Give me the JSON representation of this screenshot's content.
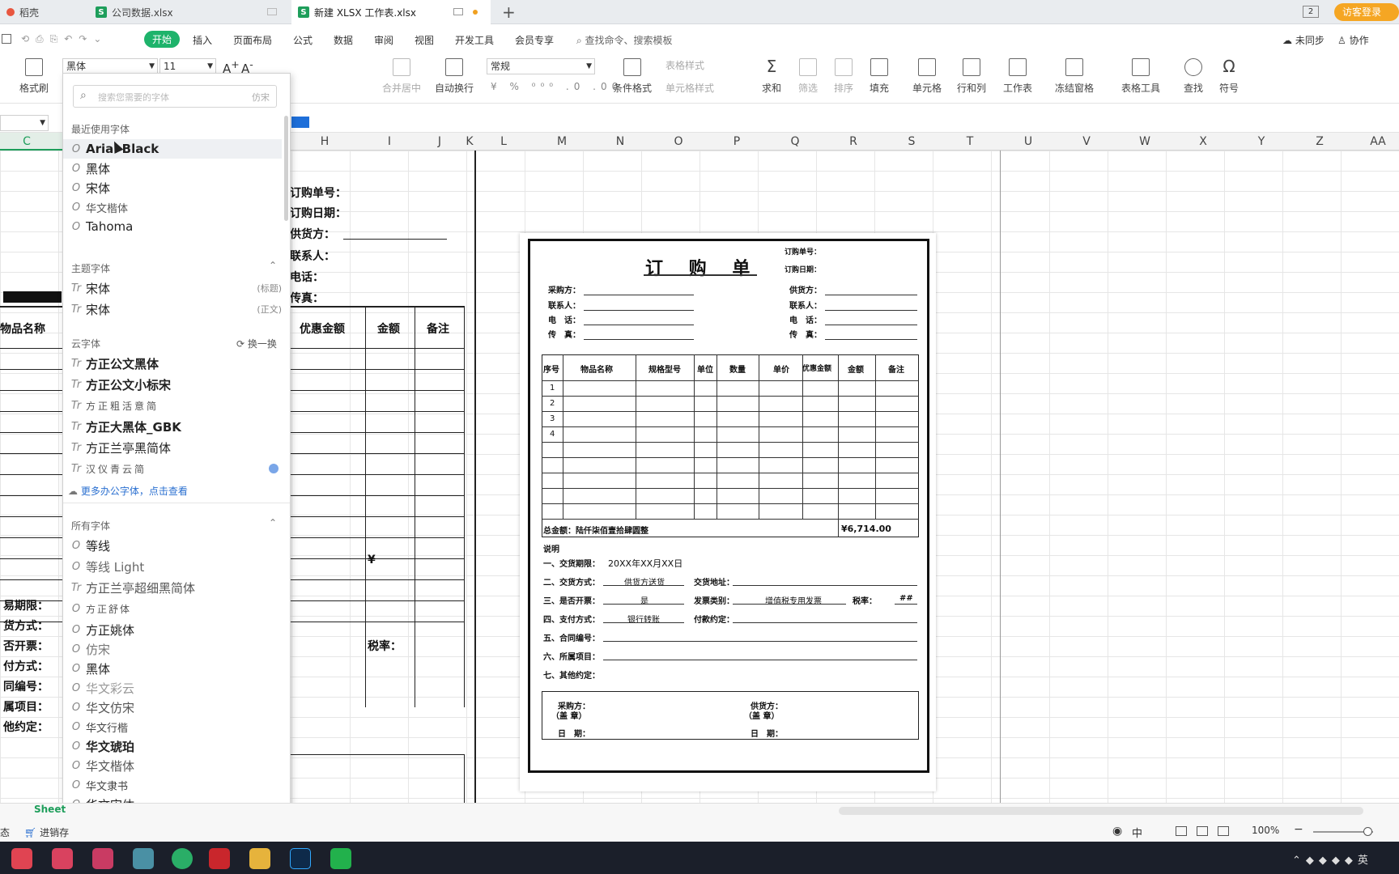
{
  "tabs": [
    {
      "label": "稻壳"
    },
    {
      "label": "公司数据.xlsx"
    },
    {
      "label": "新建 XLSX 工作表.xlsx"
    }
  ],
  "topright": {
    "login": "访客登录",
    "page_count": "2"
  },
  "menu": {
    "items": [
      "开始",
      "插入",
      "页面布局",
      "公式",
      "数据",
      "审阅",
      "视图",
      "开发工具",
      "会员专享"
    ],
    "search": "查找命令、搜索模板",
    "unsync": "未同步",
    "collab": "协作"
  },
  "ribbon": {
    "font_name": "黑体",
    "font_size": "11",
    "number_format": "常规",
    "format_painter": "格式刷",
    "merge": "合并居中",
    "wrap": "自动换行",
    "table_style": "表格样式",
    "cond_format": "条件格式",
    "cell_style": "单元格样式",
    "sum": "求和",
    "filter": "筛选",
    "sort": "排序",
    "fill": "填充",
    "cell": "单元格",
    "rowcol": "行和列",
    "sheet": "工作表",
    "freeze": "冻结窗格",
    "tools": "表格工具",
    "find": "查找",
    "symbol": "符号"
  },
  "font_dropdown": {
    "search_placeholder": "搜索您需要的字体",
    "search_hint": "仿宋",
    "recent_title": "最近使用字体",
    "recent": [
      "Arial Black",
      "黑体",
      "宋体",
      "华文楷体",
      "Tahoma"
    ],
    "theme_title": "主题字体",
    "theme": [
      {
        "name": "宋体",
        "tag": "(标题)"
      },
      {
        "name": "宋体",
        "tag": "(正文)"
      }
    ],
    "cloud_title": "云字体",
    "cloud_refresh": "换一换",
    "cloud": [
      "方正公文黑体",
      "方正公文小标宋",
      "方正粗活意简",
      "方正大黑体_GBK",
      "方正兰亭黑简体",
      "汉仪青云简"
    ],
    "more_cloud": "更多办公字体，点击查看",
    "all_title": "所有字体",
    "all": [
      "等线",
      "等线 Light",
      "方正兰亭超细黑简体",
      "方正舒体",
      "方正姚体",
      "仿宋",
      "黑体",
      "华文彩云",
      "华文仿宋",
      "华文行楷",
      "华文琥珀",
      "华文楷体",
      "华文隶书",
      "华文宋体"
    ]
  },
  "columns": [
    "C",
    "H",
    "I",
    "J",
    "K",
    "L",
    "M",
    "N",
    "O",
    "P",
    "Q",
    "R",
    "S",
    "T",
    "U",
    "V",
    "W",
    "X",
    "Y",
    "Z",
    "AA"
  ],
  "sheet_labels": {
    "order_no": "订购单号：",
    "order_date": "订购日期：",
    "supplier": "供货方：",
    "contact": "联系人：",
    "phone": "电话：",
    "fax": "传真：",
    "discount": "优惠金额",
    "amount": "金额",
    "remark": "备注",
    "item_name": "物品名称",
    "yen": "¥",
    "trade_period": "易期限：",
    "delivery": "货方式：",
    "invoice": "否开票：",
    "payment": "付方式：",
    "contract": "同编号：",
    "project": "属项目：",
    "other": "他约定：",
    "tax": "税率："
  },
  "preview": {
    "title": "订 购 单",
    "order_no": "订购单号：",
    "order_date": "订购日期：",
    "buyer": "采购方：",
    "supplier": "供货方：",
    "contact": "联系人：",
    "phone": "电　话：",
    "fax": "传　真：",
    "headers": [
      "序号",
      "物品名称",
      "规格型号",
      "单位",
      "数量",
      "单价",
      "优惠金额",
      "金额",
      "备注"
    ],
    "rows": [
      "1",
      "2",
      "3",
      "4"
    ],
    "total_label": "总金额：陆仟柒佰壹拾肆圆整",
    "total_value": "¥6,714.00",
    "note": "说明",
    "trade_period": "一、交货期限：",
    "trade_period_val": "20XX年XX月XX日",
    "delivery": "二、交货方式：",
    "delivery_val": "供货方送货",
    "delivery_addr": "交货地址：",
    "invoice": "三、是否开票：",
    "invoice_val": "是",
    "invoice_type": "发票类别：",
    "invoice_type_val": "增值税专用发票",
    "tax": "税率：",
    "tax_val": "##",
    "payment": "四、支付方式：",
    "payment_val": "银行转账",
    "payment_terms": "付款约定：",
    "contract": "五、合同编号：",
    "project": "六、所属项目：",
    "other": "七、其他约定：",
    "sign_buyer": "采购方：",
    "sign_supplier": "供货方：",
    "seal": "（盖 章）",
    "date": "日　期："
  },
  "status": {
    "sheet": "Sheet",
    "zoom": "100%",
    "state": "态",
    "sales": "进销存"
  }
}
